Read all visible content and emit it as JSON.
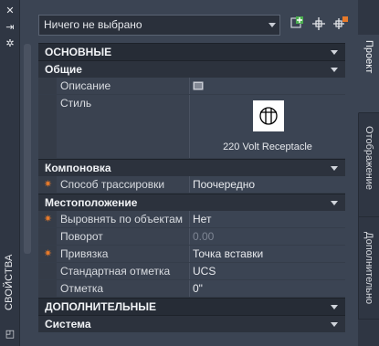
{
  "panel": {
    "title": "СВОЙСТВА",
    "selector_value": "Ничего не выбрано"
  },
  "sections": {
    "basic": "ОСНОВНЫЕ",
    "general": "Общие",
    "layout": "Компоновка",
    "location": "Местоположение",
    "additional": "ДОПОЛНИТЕЛЬНЫЕ",
    "system": "Система"
  },
  "properties": {
    "description": {
      "label": "Описание",
      "value": ""
    },
    "style": {
      "label": "Стиль",
      "caption": "220 Volt Receptacle"
    },
    "routing": {
      "label": "Способ трассировки",
      "value": "Поочередно"
    },
    "align": {
      "label": "Выровнять по объектам",
      "value": "Нет"
    },
    "rotation": {
      "label": "Поворот",
      "value": "0.00"
    },
    "anchor": {
      "label": "Привязка",
      "value": "Точка вставки"
    },
    "std_elev": {
      "label": "Стандартная отметка",
      "value": "UCS"
    },
    "elev": {
      "label": "Отметка",
      "value": "0\""
    }
  },
  "tabs": {
    "project": "Проект",
    "display": "Отображение",
    "extended": "Дополнительно"
  },
  "colors": {
    "accent_star": "#e87a2a",
    "panel_bg": "#3b4453",
    "section_bg": "#262c36"
  }
}
